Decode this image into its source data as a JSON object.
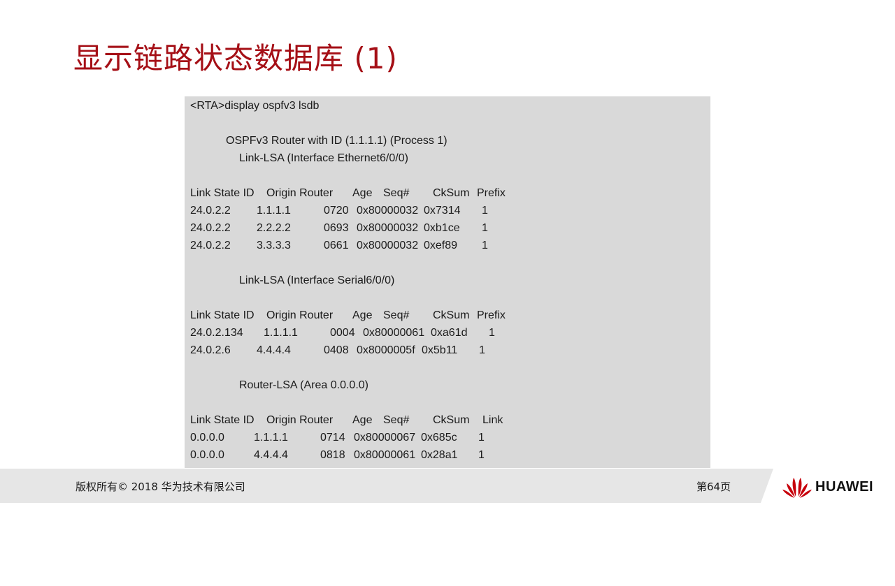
{
  "slide": {
    "title": "显示链路状态数据库 (1)"
  },
  "cli": {
    "command": "<RTA>display ospfv3 lsdb",
    "router_header": "OSPFv3 Router with ID (1.1.1.1) (Process 1)",
    "sections": [
      {
        "heading": "Link-LSA (Interface Ethernet6/0/0)",
        "columns": [
          "Link State ID",
          "Origin Router",
          "Age",
          "Seq#",
          "CkSum",
          "Prefix"
        ],
        "rows": [
          [
            "24.0.2.2",
            "1.1.1.1",
            "0720",
            "0x80000032",
            "0x7314",
            "1"
          ],
          [
            "24.0.2.2",
            "2.2.2.2",
            "0693",
            "0x80000032",
            "0xb1ce",
            "1"
          ],
          [
            "24.0.2.2",
            "3.3.3.3",
            "0661",
            "0x80000032",
            "0xef89",
            "1"
          ]
        ]
      },
      {
        "heading": "Link-LSA (Interface Serial6/0/0)",
        "columns": [
          "Link State ID",
          "Origin Router",
          "Age",
          "Seq#",
          "CkSum",
          "Prefix"
        ],
        "rows": [
          [
            "24.0.2.134",
            "1.1.1.1",
            "0004",
            "0x80000061",
            "0xa61d",
            "1"
          ],
          [
            "24.0.2.6",
            "4.4.4.4",
            "0408",
            "0x8000005f",
            "0x5b11",
            "1"
          ]
        ]
      },
      {
        "heading": "Router-LSA (Area 0.0.0.0)",
        "columns": [
          "Link State ID",
          "Origin Router",
          "Age",
          "Seq#",
          "CkSum",
          "Link"
        ],
        "rows": [
          [
            "0.0.0.0",
            "1.1.1.1",
            "0714",
            "0x80000067",
            "0x685c",
            "1"
          ],
          [
            "0.0.0.0",
            "4.4.4.4",
            "0818",
            "0x80000061",
            "0x28a1",
            "1"
          ]
        ]
      }
    ]
  },
  "footer": {
    "copyright": "版权所有© 2018 华为技术有限公司",
    "page": "第64页",
    "brand": "HUAWEI",
    "brand_color": "#c7000b"
  },
  "colors": {
    "title": "#a50f16",
    "cli_background": "#d9d9d9",
    "footer_background": "#e6e6e6"
  }
}
